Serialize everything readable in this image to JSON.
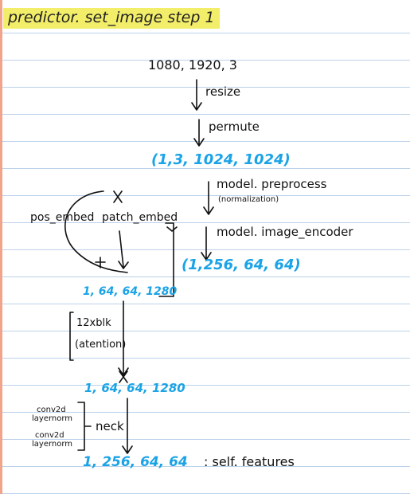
{
  "title": "predictor. set_image step 1",
  "nodes": {
    "input_shape": "1080, 1920, 3",
    "resize": "resize",
    "permute": "permute",
    "tensor_1x3": "(1,3, 1024, 1024)",
    "model_preprocess": "model. preprocess",
    "normalization": "(normalization)",
    "model_image_encoder": "model. image_encoder",
    "tensor_1x256_64": "(1,256, 64, 64)",
    "pos_embed": "pos_embed",
    "patch_embed": "patch_embed",
    "tensor_1x64_1280": "1, 64, 64, 1280",
    "blocks": "12xblk",
    "attention": "(atention)",
    "tensor_1x64_1280_b": "1, 64, 64, 1280",
    "neck_layers": [
      "conv2d",
      "layernorm",
      "conv2d",
      "layernorm"
    ],
    "neck": "neck",
    "output": "1, 256, 64, 64",
    "self_features": ": self. features"
  },
  "colors": {
    "highlight": "#f3ee6a",
    "ink": "#111111",
    "shape_blue": "#1aa3e6",
    "rule_line": "#bcd2ea",
    "margin": "#f2a48a"
  }
}
